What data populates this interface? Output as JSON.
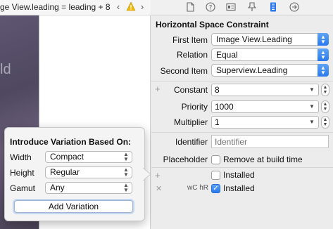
{
  "jump_bar": {
    "constraint_text": "ge View.leading = leading + 8"
  },
  "canvas": {
    "image_glyph": "ld"
  },
  "popover": {
    "title": "Introduce Variation Based On:",
    "width_label": "Width",
    "width_value": "Compact",
    "height_label": "Height",
    "height_value": "Regular",
    "gamut_label": "Gamut",
    "gamut_value": "Any",
    "add_button": "Add Variation"
  },
  "inspector": {
    "toolbar_icons": [
      "file-icon",
      "help-icon",
      "identity-icon",
      "attributes-icon",
      "size-icon",
      "connections-icon"
    ],
    "section_title": "Horizontal Space Constraint",
    "first_item_label": "First Item",
    "first_item_value": "Image View.Leading",
    "relation_label": "Relation",
    "relation_value": "Equal",
    "second_item_label": "Second Item",
    "second_item_value": "Superview.Leading",
    "constant_label": "Constant",
    "constant_value": "8",
    "priority_label": "Priority",
    "priority_value": "1000",
    "multiplier_label": "Multiplier",
    "multiplier_value": "1",
    "identifier_label": "Identifier",
    "identifier_placeholder": "Identifier",
    "placeholder_label": "Placeholder",
    "placeholder_check_label": "Remove at build time",
    "installed_label": "Installed",
    "variation_label": "wC hR",
    "variation_installed_label": "Installed"
  },
  "colors": {
    "accent": "#2a78f0",
    "background": "#ececec",
    "warning": "#f2b705"
  }
}
